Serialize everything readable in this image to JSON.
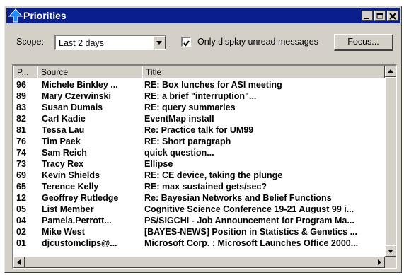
{
  "window": {
    "title": "Priorities",
    "colors": {
      "titlebar": "#0a1f8c",
      "face": "#d4d0c8",
      "icon": "#1e8cff"
    },
    "icons": {
      "app": "up-arrow-icon",
      "minimize": "minimize-icon",
      "maximize": "maximize-icon",
      "close": "close-icon"
    }
  },
  "toolbar": {
    "scope_label": "Scope:",
    "scope_value": "Last 2 days",
    "only_unread_label": "Only display unread messages",
    "only_unread_checked": true,
    "focus_label": "Focus..."
  },
  "list": {
    "columns": [
      "P...",
      "Source",
      "Title"
    ],
    "rows": [
      {
        "priority": "96",
        "source": "Michele Binkley ...",
        "title": "RE: Box lunches for ASI meeting"
      },
      {
        "priority": "89",
        "source": "Mary Czerwinski",
        "title": "RE: a brief \"interruption\"..."
      },
      {
        "priority": "83",
        "source": "Susan Dumais",
        "title": "RE: query summaries"
      },
      {
        "priority": "82",
        "source": "Carl Kadie",
        "title": "EventMap install"
      },
      {
        "priority": "81",
        "source": "Tessa Lau",
        "title": "Re: Practice talk for UM99"
      },
      {
        "priority": "76",
        "source": "Tim Paek",
        "title": "RE: Short paragraph"
      },
      {
        "priority": "74",
        "source": "Sam Reich",
        "title": "quick question..."
      },
      {
        "priority": "73",
        "source": "Tracy Rex",
        "title": "Ellipse"
      },
      {
        "priority": "69",
        "source": "Kevin Shields",
        "title": "RE: CE device, taking the plunge"
      },
      {
        "priority": "65",
        "source": "Terence Kelly",
        "title": "RE: max sustained gets/sec?"
      },
      {
        "priority": "12",
        "source": "Geoffrey Rutledge",
        "title": "Re: Bayesian Networks and Belief Functions"
      },
      {
        "priority": "05",
        "source": "List Member",
        "title": "Cognitive Science Conference 19-21 August 99 i..."
      },
      {
        "priority": "04",
        "source": "Pamela.Perrott...",
        "title": "PS/SIGCHI - Job Announcement for Program Ma..."
      },
      {
        "priority": "02",
        "source": "Mike West",
        "title": "[BAYES-NEWS] Position in Statistics & Genetics ..."
      },
      {
        "priority": "01",
        "source": "djcustomclips@...",
        "title": "Microsoft Corp. : Microsoft Launches Office 2000..."
      }
    ]
  }
}
